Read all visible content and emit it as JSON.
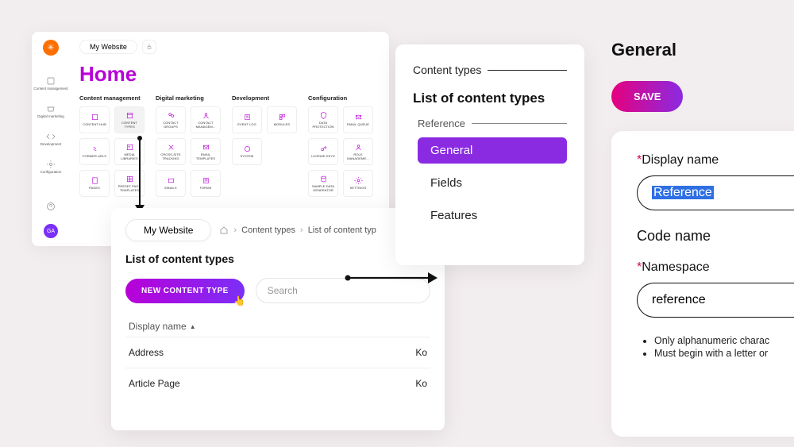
{
  "panel1": {
    "site_name": "My Website",
    "title": "Home",
    "sidebar": [
      {
        "label": "Content management"
      },
      {
        "label": "Digital marketing"
      },
      {
        "label": "Development"
      },
      {
        "label": "Configuration"
      }
    ],
    "user_initials": "GA",
    "sections": {
      "content_management": {
        "heading": "Content management",
        "tiles": [
          "CONTENT HUB",
          "CONTENT TYPES",
          "FORMER URLS",
          "MEDIA LIBRARIES",
          "PAGES",
          "PRESET PAGE TEMPLATES"
        ]
      },
      "digital_marketing": {
        "heading": "Digital marketing",
        "tiles": [
          "CONTACT GROUPS",
          "CONTACT MANAGEM...",
          "CROSS-SITE TRACKING",
          "EMAIL TEMPLATES",
          "EMAILS",
          "FORMS"
        ]
      },
      "development": {
        "heading": "Development",
        "tiles": [
          "EVENT LOG",
          "MODULES",
          "SYSTEM"
        ]
      },
      "configuration": {
        "heading": "Configuration",
        "tiles": [
          "DATA PROTECTION",
          "EMAIL QUEUE",
          "LICENSE KEYS",
          "ROLE MANAGEME...",
          "SAMPLE DATA GENERATOR",
          "SETTINGS"
        ]
      }
    }
  },
  "panel2": {
    "breadcrumb_site": "My Website",
    "breadcrumb": [
      "Content types",
      "List of content typ"
    ],
    "title": "List of content types",
    "new_button": "NEW CONTENT TYPE",
    "search_placeholder": "Search",
    "column_header": "Display name",
    "rows": [
      {
        "name": "Address",
        "trail": "Ko"
      },
      {
        "name": "Article Page",
        "trail": "Ko"
      }
    ]
  },
  "panel3": {
    "crumb": "Content types",
    "title": "List of content types",
    "sub": "Reference",
    "nav": [
      "General",
      "Fields",
      "Features"
    ],
    "active": "General"
  },
  "panel4": {
    "title": "General",
    "save_label": "SAVE",
    "display_name_label": "Display name",
    "display_name_value": "Reference",
    "code_name_heading": "Code name",
    "namespace_label": "Namespace",
    "namespace_value": "reference",
    "hints": [
      "Only alphanumeric charac",
      "Must begin with a letter or"
    ]
  }
}
